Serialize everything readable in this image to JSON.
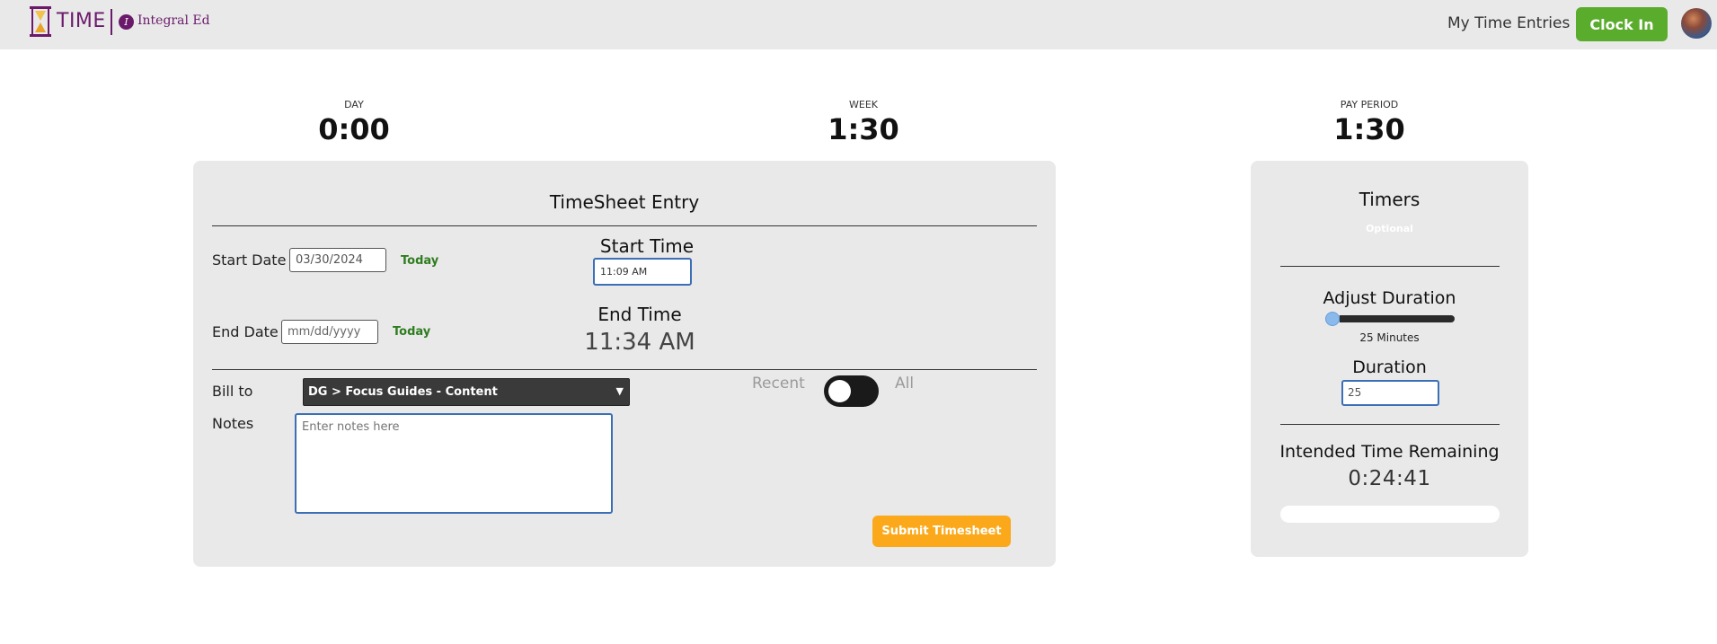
{
  "header": {
    "app_name": "TIME",
    "org_name": "Integral Ed",
    "org_mark": "I",
    "nav_my_entries": "My Time Entries",
    "clock_in_label": "Clock In",
    "brand_color": "#6b1a6b",
    "clock_in_color": "#5aac2c"
  },
  "stats": {
    "day": {
      "label": "DAY",
      "value": "0:00"
    },
    "week": {
      "label": "WEEK",
      "value": "1:30"
    },
    "pay_period": {
      "label": "PAY PERIOD",
      "value": "1:30"
    }
  },
  "timesheet": {
    "title": "TimeSheet Entry",
    "start_date_label": "Start Date",
    "start_date_value": "03/30/2024",
    "today_label": "Today",
    "start_time_heading": "Start Time",
    "start_time_value": "11:09  AM",
    "end_date_label": "End Date",
    "end_date_placeholder": "mm/dd/yyyy",
    "end_time_heading": "End Time",
    "end_time_value": "11:34 AM",
    "bill_to_label": "Bill to",
    "bill_to_value": "DG > Focus Guides - Content",
    "toggle_left_label": "Recent",
    "toggle_right_label": "All",
    "notes_label": "Notes",
    "notes_placeholder": "Enter notes here",
    "submit_label": "Submit Timesheet",
    "submit_color": "#fba91a"
  },
  "timers": {
    "title": "Timers",
    "subtitle": "Optional",
    "adjust_duration_heading": "Adjust Duration",
    "slider_value_minutes": 25,
    "slider_caption": "25 Minutes",
    "duration_heading": "Duration",
    "duration_value": "25",
    "intended_remaining_heading": "Intended Time Remaining",
    "intended_remaining_value": "0:24:41"
  }
}
